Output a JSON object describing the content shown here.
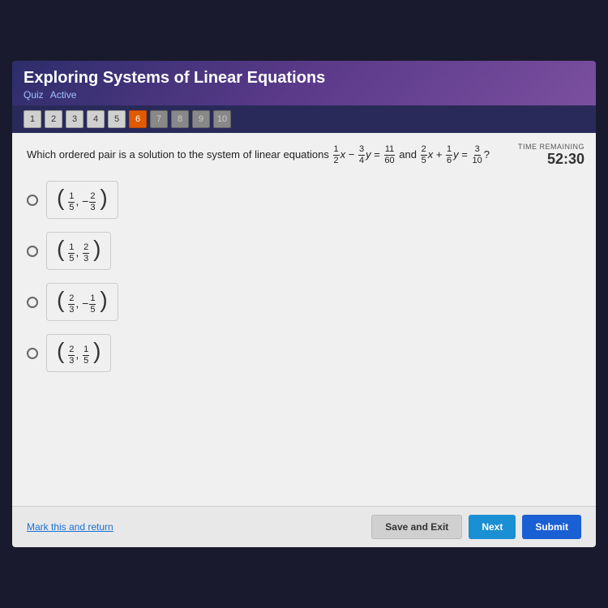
{
  "app": {
    "title": "Exploring Systems of Linear Equations",
    "quiz_label": "Quiz",
    "status": "Active"
  },
  "nav": {
    "buttons": [
      {
        "num": "1",
        "state": "normal"
      },
      {
        "num": "2",
        "state": "normal"
      },
      {
        "num": "3",
        "state": "normal"
      },
      {
        "num": "4",
        "state": "normal"
      },
      {
        "num": "5",
        "state": "normal"
      },
      {
        "num": "6",
        "state": "active"
      },
      {
        "num": "7",
        "state": "dimmed"
      },
      {
        "num": "8",
        "state": "dimmed"
      },
      {
        "num": "9",
        "state": "dimmed"
      },
      {
        "num": "10",
        "state": "dimmed"
      }
    ]
  },
  "timer": {
    "label": "TIME REMAINING",
    "value": "52:30"
  },
  "question": {
    "text": "Which ordered pair is a solution to the system of linear equations",
    "eq1": "1/2 x − 3/4 y = 11/60",
    "eq2": "2/5 x + 1/6 y = 3/10",
    "connector": "and"
  },
  "options": [
    {
      "label": "(1/5, −2/3)",
      "a_num": "1",
      "a_den": "5",
      "b_neg": true,
      "b_num": "2",
      "b_den": "3"
    },
    {
      "label": "(1/5, 2/3)",
      "a_num": "1",
      "a_den": "5",
      "b_neg": false,
      "b_num": "2",
      "b_den": "3"
    },
    {
      "label": "(2/3, −1/5)",
      "a_num": "2",
      "a_den": "3",
      "b_neg": true,
      "b_num": "1",
      "b_den": "5"
    },
    {
      "label": "(2/3, 1/5)",
      "a_num": "2",
      "a_den": "3",
      "b_neg": false,
      "b_num": "1",
      "b_den": "5"
    }
  ],
  "footer": {
    "mark_link": "Mark this and return",
    "save_exit": "Save and Exit",
    "next": "Next",
    "submit": "Submit"
  }
}
